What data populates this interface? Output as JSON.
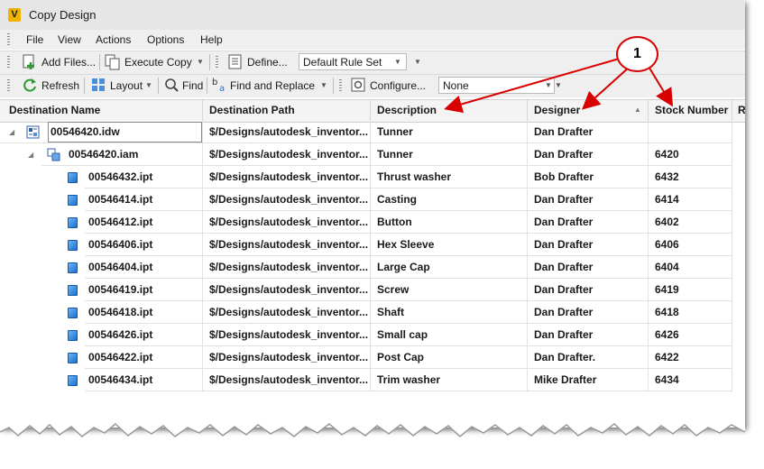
{
  "window": {
    "title": "Copy Design",
    "app_icon_letter": "V"
  },
  "menu": [
    "File",
    "View",
    "Actions",
    "Options",
    "Help"
  ],
  "toolbar1": {
    "add_files": "Add Files...",
    "execute_copy": "Execute Copy",
    "define": "Define...",
    "rule_set": "Default Rule Set"
  },
  "toolbar2": {
    "refresh": "Refresh",
    "layout": "Layout",
    "find": "Find",
    "find_replace": "Find and Replace",
    "configure": "Configure...",
    "config_value": "None"
  },
  "columns": [
    "Destination Name",
    "Destination Path",
    "Description",
    "Designer",
    "Stock Number",
    "R"
  ],
  "rows": [
    {
      "name": "00546420.idw",
      "path": "$/Designs/autodesk_inventor...",
      "desc": "Tunner",
      "designer": "Dan Drafter",
      "stock": "",
      "type": "idw",
      "expanded": true
    },
    {
      "name": "00546420.iam",
      "path": "$/Designs/autodesk_inventor...",
      "desc": "Tunner",
      "designer": "Dan Drafter",
      "stock": "6420",
      "type": "iam",
      "expanded": true
    },
    {
      "name": "00546432.ipt",
      "path": "$/Designs/autodesk_inventor...",
      "desc": "Thrust washer",
      "designer": "Bob Drafter",
      "stock": "6432",
      "type": "ipt"
    },
    {
      "name": "00546414.ipt",
      "path": "$/Designs/autodesk_inventor...",
      "desc": "Casting",
      "designer": "Dan Drafter",
      "stock": "6414",
      "type": "ipt"
    },
    {
      "name": "00546412.ipt",
      "path": "$/Designs/autodesk_inventor...",
      "desc": "Button",
      "designer": "Dan Drafter",
      "stock": "6402",
      "type": "ipt"
    },
    {
      "name": "00546406.ipt",
      "path": "$/Designs/autodesk_inventor...",
      "desc": "Hex Sleeve",
      "designer": "Dan Drafter",
      "stock": "6406",
      "type": "ipt"
    },
    {
      "name": "00546404.ipt",
      "path": "$/Designs/autodesk_inventor...",
      "desc": "Large Cap",
      "designer": "Dan Drafter",
      "stock": "6404",
      "type": "ipt"
    },
    {
      "name": "00546419.ipt",
      "path": "$/Designs/autodesk_inventor...",
      "desc": "Screw",
      "designer": "Dan Drafter",
      "stock": "6419",
      "type": "ipt"
    },
    {
      "name": "00546418.ipt",
      "path": "$/Designs/autodesk_inventor...",
      "desc": "Shaft",
      "designer": "Dan Drafter",
      "stock": "6418",
      "type": "ipt"
    },
    {
      "name": "00546426.ipt",
      "path": "$/Designs/autodesk_inventor...",
      "desc": "Small cap",
      "designer": "Dan Drafter",
      "stock": "6426",
      "type": "ipt"
    },
    {
      "name": "00546422.ipt",
      "path": "$/Designs/autodesk_inventor...",
      "desc": "Post Cap",
      "designer": "Dan Drafter.",
      "stock": "6422",
      "type": "ipt"
    },
    {
      "name": "00546434.ipt",
      "path": "$/Designs/autodesk_inventor...",
      "desc": "Trim washer",
      "designer": "Mike Drafter",
      "stock": "6434",
      "type": "ipt"
    }
  ],
  "callout": {
    "label": "1",
    "color": "#d80000"
  },
  "colors": {
    "accent_blue": "#1c6fd0",
    "app_icon": "#f0b400"
  }
}
